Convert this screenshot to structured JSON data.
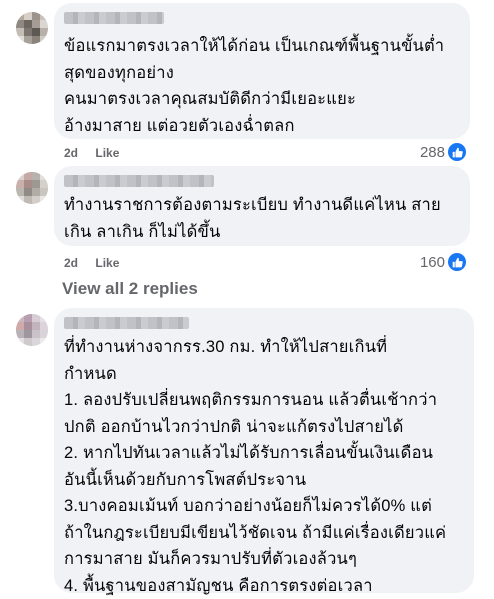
{
  "comments": [
    {
      "author": "",
      "lines": [
        "ข้อแรกมาตรงเวลาให้ได้ก่อน เป็นเกณฑ์พื้นฐานขั้นต่ำ",
        "สุดของทุกอย่าง",
        "คนมาตรงเวลาคุณสมบัติดีกว่ามีเยอะแยะ",
        "อ้างมาสาย แต่อวยตัวเองฉ่ำตลก"
      ],
      "time": "2d",
      "like_label": "Like",
      "reaction_count": "288"
    },
    {
      "author": "",
      "lines": [
        "ทำงานราชการต้องตามระเบียบ ทำงานดีแค่ไหน สาย",
        "เกิน ลาเกิน ก็ไม่ได้ขึ้น"
      ],
      "time": "2d",
      "like_label": "Like",
      "reaction_count": "160"
    },
    {
      "author": "",
      "lines": [
        "ที่ทำงานห่างจากรร.30 กม. ทำให้ไปสายเกินที่",
        "กำหนด",
        "1. ลองปรับเปลี่ยนพฤติกรรมการนอน แล้วตื่นเช้ากว่า",
        "ปกติ ออกบ้านไวกว่าปกติ น่าจะแก้ตรงไปสายได้",
        "2. หากไปทันเวลาแล้วไม่ได้รับการเลื่อนขั้นเงินเดือน",
        "อันนี้เห็นด้วยกับการโพสต์ประจาน",
        "3.บางคอมเม้นท์ บอกว่าอย่างน้อยก็ไม่ควรได้0% แต่",
        "ถ้าในกฎระเบียบมีเขียนไว้ชัดเจน ถ้ามีแค่เรื่องเดียวแค่",
        "การมาสาย มันก็ควรมาปรับที่ตัวเองล้วนๆ",
        "4. พื้นฐานของสามัญชน คือการตรงต่อเวลา"
      ]
    }
  ],
  "view_replies_label": "View all 2 replies",
  "icons": {
    "like_reaction": "thumbs-up-icon",
    "like_color": "#1877f2"
  }
}
